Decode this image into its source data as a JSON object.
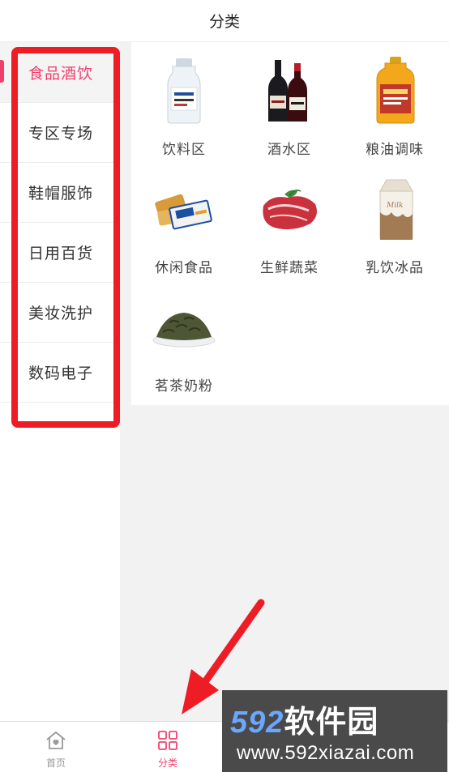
{
  "header": {
    "title": "分类"
  },
  "sidebar": {
    "items": [
      {
        "label": "食品酒饮",
        "active": true
      },
      {
        "label": "专区专场",
        "active": false
      },
      {
        "label": "鞋帽服饰",
        "active": false
      },
      {
        "label": "日用百货",
        "active": false
      },
      {
        "label": "美妆洗护",
        "active": false
      },
      {
        "label": "数码电子",
        "active": false
      }
    ]
  },
  "categories": [
    {
      "label": "饮料区",
      "icon": "water-bottle-icon"
    },
    {
      "label": "酒水区",
      "icon": "wine-bottles-icon"
    },
    {
      "label": "粮油调味",
      "icon": "oil-bottle-icon"
    },
    {
      "label": "休闲食品",
      "icon": "snack-biscuit-icon"
    },
    {
      "label": "生鲜蔬菜",
      "icon": "raw-meat-icon"
    },
    {
      "label": "乳饮冰品",
      "icon": "milk-carton-icon"
    },
    {
      "label": "茗茶奶粉",
      "icon": "tea-leaves-icon"
    }
  ],
  "tabbar": {
    "tabs": [
      {
        "label": "首页",
        "icon": "home-icon",
        "active": false
      },
      {
        "label": "分类",
        "icon": "grid-icon",
        "active": true
      }
    ]
  },
  "watermark": {
    "logo_num": "592",
    "logo_cn": "软件园",
    "url": "www.592xiazai.com"
  },
  "colors": {
    "accent": "#f0416d",
    "annotation": "#ee1c25"
  }
}
